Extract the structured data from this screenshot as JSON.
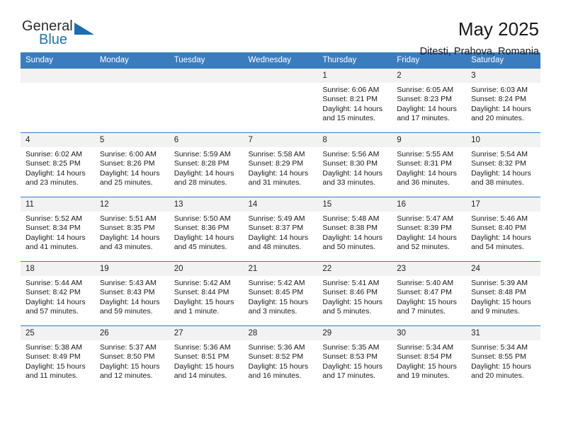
{
  "brand": {
    "line1": "General",
    "line2": "Blue",
    "accent_color": "#1b75bb",
    "triangle_color": "#1b6cb0"
  },
  "header": {
    "title": "May 2025",
    "subtitle": "Ditesti, Prahova, Romania"
  },
  "calendar": {
    "header_bg": "#3b7cbf",
    "daynum_bg": "#f2f2f2",
    "weekday_headers": [
      "Sunday",
      "Monday",
      "Tuesday",
      "Wednesday",
      "Thursday",
      "Friday",
      "Saturday"
    ],
    "weeks": [
      [
        {
          "day": "",
          "info": ""
        },
        {
          "day": "",
          "info": ""
        },
        {
          "day": "",
          "info": ""
        },
        {
          "day": "",
          "info": ""
        },
        {
          "day": "1",
          "info": "Sunrise: 6:06 AM\nSunset: 8:21 PM\nDaylight: 14 hours\nand 15 minutes."
        },
        {
          "day": "2",
          "info": "Sunrise: 6:05 AM\nSunset: 8:23 PM\nDaylight: 14 hours\nand 17 minutes."
        },
        {
          "day": "3",
          "info": "Sunrise: 6:03 AM\nSunset: 8:24 PM\nDaylight: 14 hours\nand 20 minutes."
        }
      ],
      [
        {
          "day": "4",
          "info": "Sunrise: 6:02 AM\nSunset: 8:25 PM\nDaylight: 14 hours\nand 23 minutes."
        },
        {
          "day": "5",
          "info": "Sunrise: 6:00 AM\nSunset: 8:26 PM\nDaylight: 14 hours\nand 25 minutes."
        },
        {
          "day": "6",
          "info": "Sunrise: 5:59 AM\nSunset: 8:28 PM\nDaylight: 14 hours\nand 28 minutes."
        },
        {
          "day": "7",
          "info": "Sunrise: 5:58 AM\nSunset: 8:29 PM\nDaylight: 14 hours\nand 31 minutes."
        },
        {
          "day": "8",
          "info": "Sunrise: 5:56 AM\nSunset: 8:30 PM\nDaylight: 14 hours\nand 33 minutes."
        },
        {
          "day": "9",
          "info": "Sunrise: 5:55 AM\nSunset: 8:31 PM\nDaylight: 14 hours\nand 36 minutes."
        },
        {
          "day": "10",
          "info": "Sunrise: 5:54 AM\nSunset: 8:32 PM\nDaylight: 14 hours\nand 38 minutes."
        }
      ],
      [
        {
          "day": "11",
          "info": "Sunrise: 5:52 AM\nSunset: 8:34 PM\nDaylight: 14 hours\nand 41 minutes."
        },
        {
          "day": "12",
          "info": "Sunrise: 5:51 AM\nSunset: 8:35 PM\nDaylight: 14 hours\nand 43 minutes."
        },
        {
          "day": "13",
          "info": "Sunrise: 5:50 AM\nSunset: 8:36 PM\nDaylight: 14 hours\nand 45 minutes."
        },
        {
          "day": "14",
          "info": "Sunrise: 5:49 AM\nSunset: 8:37 PM\nDaylight: 14 hours\nand 48 minutes."
        },
        {
          "day": "15",
          "info": "Sunrise: 5:48 AM\nSunset: 8:38 PM\nDaylight: 14 hours\nand 50 minutes."
        },
        {
          "day": "16",
          "info": "Sunrise: 5:47 AM\nSunset: 8:39 PM\nDaylight: 14 hours\nand 52 minutes."
        },
        {
          "day": "17",
          "info": "Sunrise: 5:46 AM\nSunset: 8:40 PM\nDaylight: 14 hours\nand 54 minutes."
        }
      ],
      [
        {
          "day": "18",
          "info": "Sunrise: 5:44 AM\nSunset: 8:42 PM\nDaylight: 14 hours\nand 57 minutes."
        },
        {
          "day": "19",
          "info": "Sunrise: 5:43 AM\nSunset: 8:43 PM\nDaylight: 14 hours\nand 59 minutes."
        },
        {
          "day": "20",
          "info": "Sunrise: 5:42 AM\nSunset: 8:44 PM\nDaylight: 15 hours\nand 1 minute."
        },
        {
          "day": "21",
          "info": "Sunrise: 5:42 AM\nSunset: 8:45 PM\nDaylight: 15 hours\nand 3 minutes."
        },
        {
          "day": "22",
          "info": "Sunrise: 5:41 AM\nSunset: 8:46 PM\nDaylight: 15 hours\nand 5 minutes."
        },
        {
          "day": "23",
          "info": "Sunrise: 5:40 AM\nSunset: 8:47 PM\nDaylight: 15 hours\nand 7 minutes."
        },
        {
          "day": "24",
          "info": "Sunrise: 5:39 AM\nSunset: 8:48 PM\nDaylight: 15 hours\nand 9 minutes."
        }
      ],
      [
        {
          "day": "25",
          "info": "Sunrise: 5:38 AM\nSunset: 8:49 PM\nDaylight: 15 hours\nand 11 minutes."
        },
        {
          "day": "26",
          "info": "Sunrise: 5:37 AM\nSunset: 8:50 PM\nDaylight: 15 hours\nand 12 minutes."
        },
        {
          "day": "27",
          "info": "Sunrise: 5:36 AM\nSunset: 8:51 PM\nDaylight: 15 hours\nand 14 minutes."
        },
        {
          "day": "28",
          "info": "Sunrise: 5:36 AM\nSunset: 8:52 PM\nDaylight: 15 hours\nand 16 minutes."
        },
        {
          "day": "29",
          "info": "Sunrise: 5:35 AM\nSunset: 8:53 PM\nDaylight: 15 hours\nand 17 minutes."
        },
        {
          "day": "30",
          "info": "Sunrise: 5:34 AM\nSunset: 8:54 PM\nDaylight: 15 hours\nand 19 minutes."
        },
        {
          "day": "31",
          "info": "Sunrise: 5:34 AM\nSunset: 8:55 PM\nDaylight: 15 hours\nand 20 minutes."
        }
      ]
    ]
  }
}
